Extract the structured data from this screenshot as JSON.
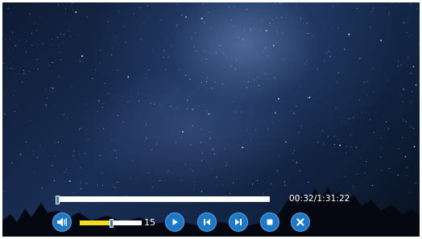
{
  "player": {
    "time_display": "00:32/1:31:22",
    "progress_fraction": 0.006,
    "volume_value": "15",
    "volume_fraction": 0.5
  },
  "controls": [
    {
      "name": "volume-button",
      "icon": "speaker-icon"
    },
    {
      "name": "play-button",
      "icon": "play-icon"
    },
    {
      "name": "previous-button",
      "icon": "skip-back-icon"
    },
    {
      "name": "next-button",
      "icon": "skip-forward-icon"
    },
    {
      "name": "stop-button",
      "icon": "stop-icon"
    },
    {
      "name": "close-button",
      "icon": "close-icon"
    }
  ],
  "colors": {
    "accent": "#1e78c8",
    "progress_fill": "#f0e020",
    "track": "#ffffff"
  }
}
